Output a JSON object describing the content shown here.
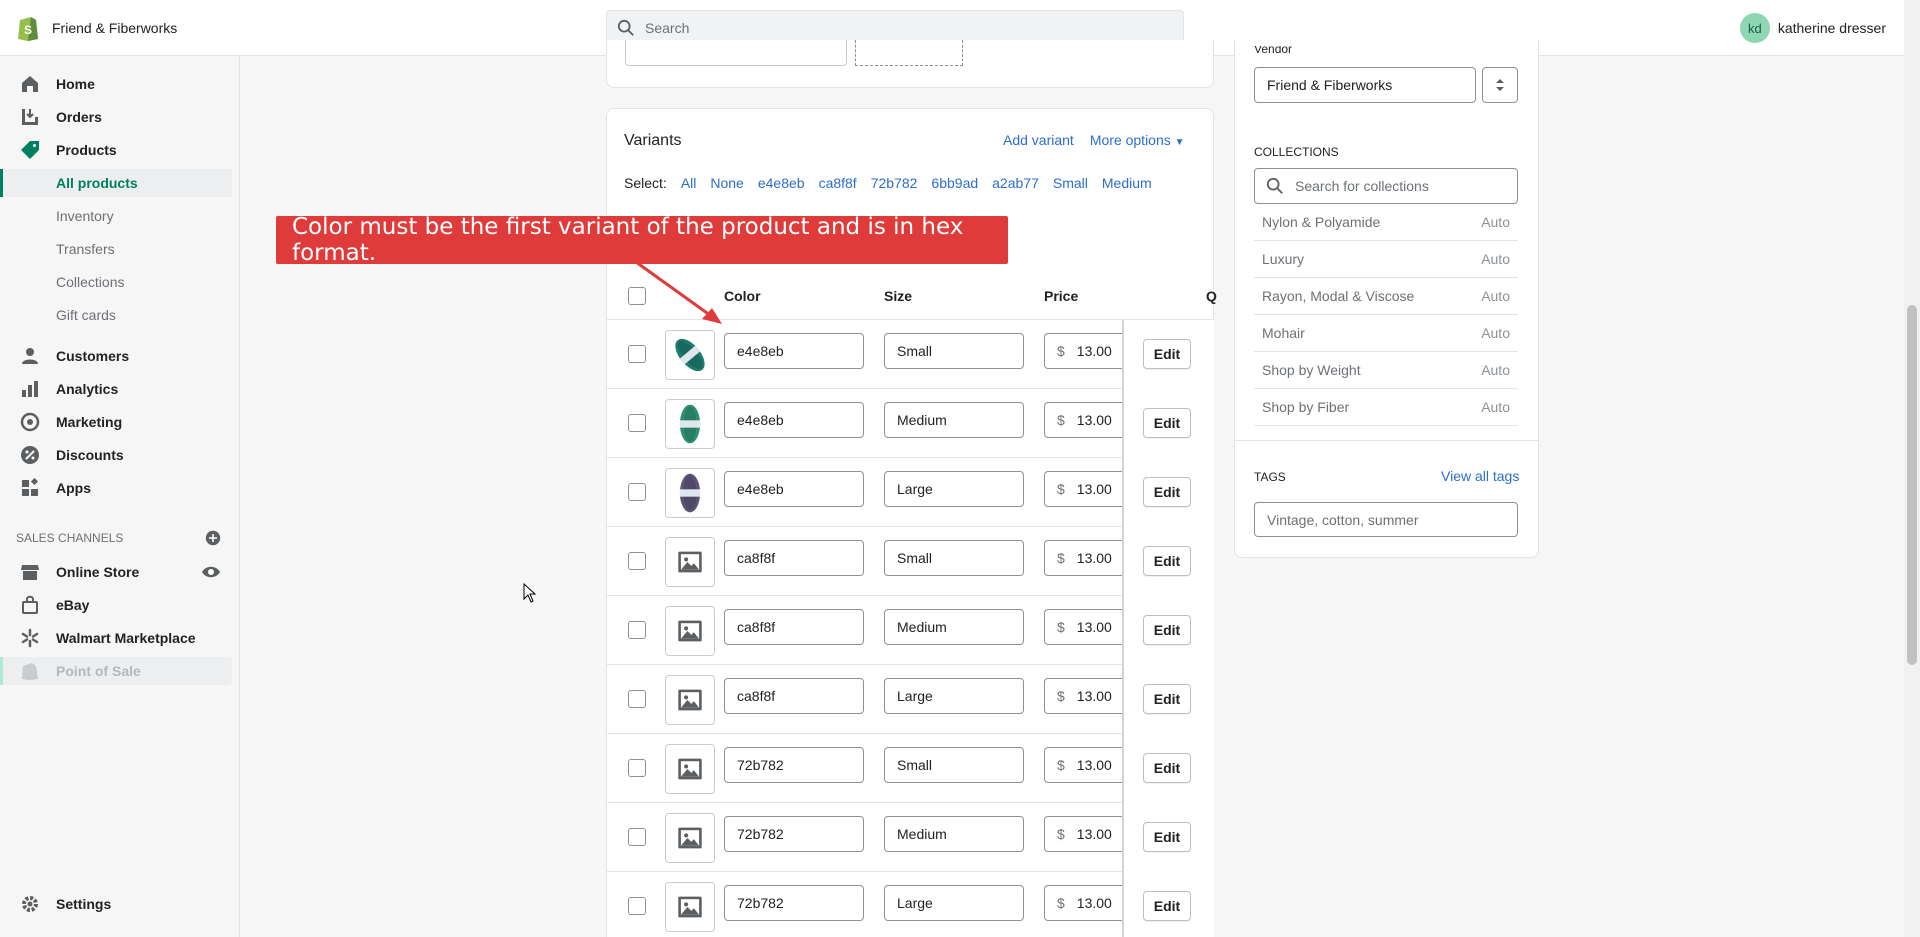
{
  "topbar": {
    "store_name": "Friend & Fiberworks",
    "search_placeholder": "Search",
    "user_initials": "kd",
    "user_name": "katherine dresser"
  },
  "sidebar": {
    "items": [
      {
        "label": "Home",
        "icon": "home-icon"
      },
      {
        "label": "Orders",
        "icon": "orders-icon"
      },
      {
        "label": "Products",
        "icon": "tag-icon"
      },
      {
        "label": "All products"
      },
      {
        "label": "Inventory"
      },
      {
        "label": "Transfers"
      },
      {
        "label": "Collections"
      },
      {
        "label": "Gift cards"
      },
      {
        "label": "Customers",
        "icon": "person-icon"
      },
      {
        "label": "Analytics",
        "icon": "bar-chart-icon"
      },
      {
        "label": "Marketing",
        "icon": "target-icon"
      },
      {
        "label": "Discounts",
        "icon": "discount-icon"
      },
      {
        "label": "Apps",
        "icon": "apps-icon"
      }
    ],
    "channels_header": "SALES CHANNELS",
    "channels": [
      {
        "label": "Online Store",
        "icon": "store-icon"
      },
      {
        "label": "eBay",
        "icon": "bag-icon"
      },
      {
        "label": "Walmart Marketplace",
        "icon": "walmart-icon"
      },
      {
        "label": "Point of Sale",
        "icon": "shopify-icon"
      }
    ],
    "settings": "Settings"
  },
  "variants": {
    "title": "Variants",
    "add_variant": "Add variant",
    "more_options": "More options",
    "select_label": "Select:",
    "select_options": [
      "All",
      "None",
      "e4e8eb",
      "ca8f8f",
      "72b782",
      "6bb9ad",
      "a2ab77",
      "Small",
      "Medium"
    ],
    "headers": {
      "color": "Color",
      "size": "Size",
      "price": "Price",
      "qty_partial": "Q"
    },
    "currency": "$",
    "edit_label": "Edit",
    "rows": [
      {
        "color": "e4e8eb",
        "size": "Small",
        "price": "13.00",
        "thumb": "yarn-teal"
      },
      {
        "color": "e4e8eb",
        "size": "Medium",
        "price": "13.00",
        "thumb": "yarn-green"
      },
      {
        "color": "e4e8eb",
        "size": "Large",
        "price": "13.00",
        "thumb": "yarn-purple"
      },
      {
        "color": "ca8f8f",
        "size": "Small",
        "price": "13.00",
        "thumb": "image-placeholder"
      },
      {
        "color": "ca8f8f",
        "size": "Medium",
        "price": "13.00",
        "thumb": "image-placeholder"
      },
      {
        "color": "ca8f8f",
        "size": "Large",
        "price": "13.00",
        "thumb": "image-placeholder"
      },
      {
        "color": "72b782",
        "size": "Small",
        "price": "13.00",
        "thumb": "image-placeholder"
      },
      {
        "color": "72b782",
        "size": "Medium",
        "price": "13.00",
        "thumb": "image-placeholder"
      },
      {
        "color": "72b782",
        "size": "Large",
        "price": "13.00",
        "thumb": "image-placeholder"
      }
    ]
  },
  "annotation": {
    "text": "Color must be the first variant of the product and is in hex format.",
    "color": "#e03b3b"
  },
  "organization": {
    "vendor_label": "Vendor",
    "vendor_value": "Friend & Fiberworks",
    "collections_label": "COLLECTIONS",
    "collections_search_placeholder": "Search for collections",
    "collections": [
      {
        "name": "Nylon & Polyamide",
        "type": "Auto"
      },
      {
        "name": "Luxury",
        "type": "Auto"
      },
      {
        "name": "Rayon, Modal & Viscose",
        "type": "Auto"
      },
      {
        "name": "Mohair",
        "type": "Auto"
      },
      {
        "name": "Shop by Weight",
        "type": "Auto"
      },
      {
        "name": "Shop by Fiber",
        "type": "Auto"
      }
    ],
    "tags_label": "TAGS",
    "view_all_tags": "View all tags",
    "tags_placeholder": "Vintage, cotton, summer"
  },
  "colors": {
    "accent_green": "#008060",
    "link_blue": "#2c6ecb"
  }
}
